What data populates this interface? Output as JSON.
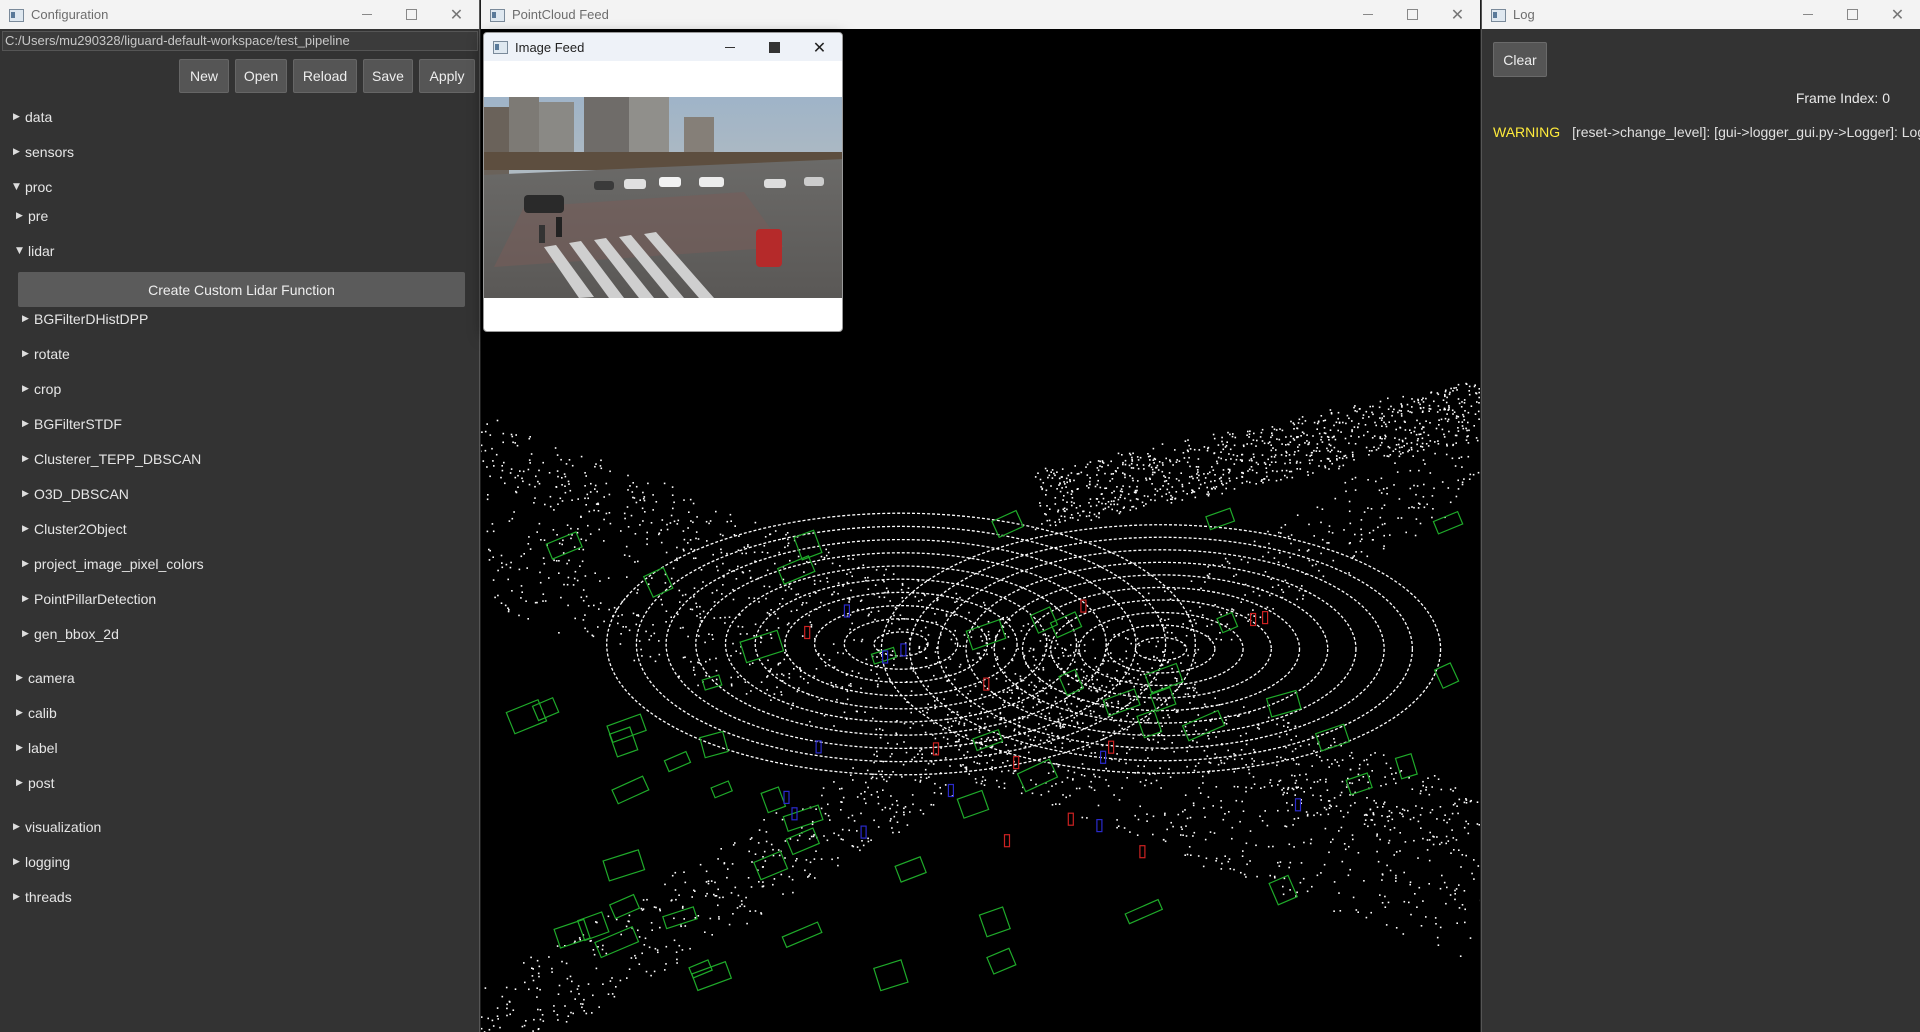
{
  "config": {
    "title": "Configuration",
    "path": "C:/Users/mu290328/liguard-default-workspace/test_pipeline",
    "toolbar": {
      "new": "New",
      "open": "Open",
      "reload": "Reload",
      "save": "Save",
      "apply": "Apply"
    },
    "tree": {
      "data": "data",
      "sensors": "sensors",
      "proc": "proc",
      "pre": "pre",
      "lidar": "lidar",
      "create_lidar": "Create Custom Lidar Function",
      "lidar_items": [
        "BGFilterDHistDPP",
        "rotate",
        "crop",
        "BGFilterSTDF",
        "Clusterer_TEPP_DBSCAN",
        "O3D_DBSCAN",
        "Cluster2Object",
        "project_image_pixel_colors",
        "PointPillarDetection",
        "gen_bbox_2d"
      ],
      "camera": "camera",
      "calib": "calib",
      "label": "label",
      "post": "post",
      "visualization": "visualization",
      "logging": "logging",
      "threads": "threads"
    },
    "expanded_marker": "▼",
    "collapsed_marker": "▶"
  },
  "pointcloud": {
    "title": "PointCloud Feed"
  },
  "imagefeed": {
    "title": "Image Feed"
  },
  "log": {
    "title": "Log",
    "clear": "Clear",
    "frame_index": "Frame Index: 0",
    "entries": [
      {
        "level": "WARNING",
        "message": "[reset->change_level]: [gui->logger_gui.py->Logger]: Logg"
      }
    ],
    "warning_color": "#ffeb3b"
  },
  "colors": {
    "panel_bg": "#333333",
    "button_bg": "#555555",
    "viewport_bg": "#000000",
    "bbox_green": "#1faa2a",
    "bbox_blue": "#2a2acc",
    "bbox_red": "#cc2222"
  },
  "icons": {
    "window_controls": [
      "minimize-icon",
      "maximize-icon",
      "close-icon"
    ],
    "tree_markers": [
      "expanded-triangle-icon",
      "collapsed-triangle-icon"
    ]
  }
}
